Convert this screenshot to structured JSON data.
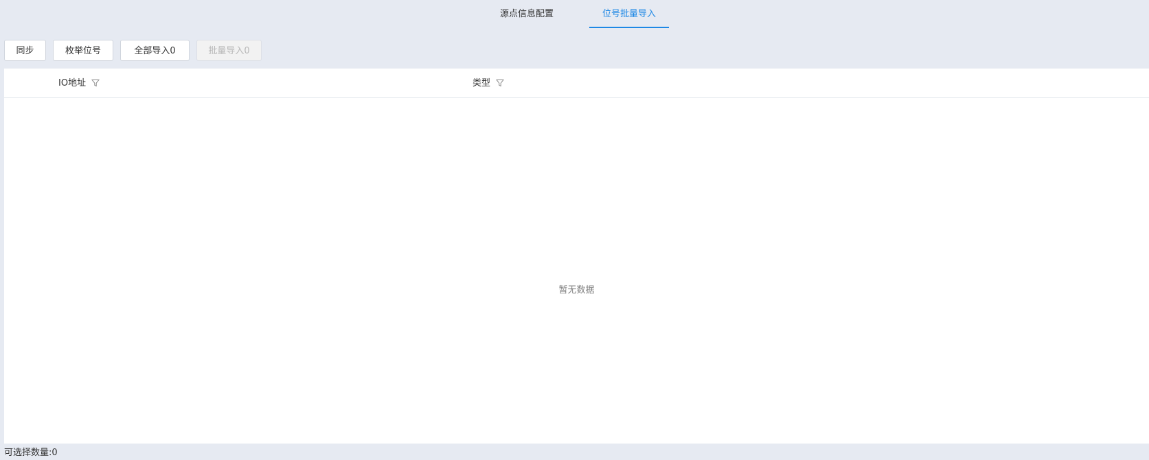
{
  "tabs": [
    {
      "label": "源点信息配置",
      "active": false
    },
    {
      "label": "位号批量导入",
      "active": true
    }
  ],
  "toolbar": {
    "sync_label": "同步",
    "enumerate_label": "枚举位号",
    "import_all_label": "全部导入0",
    "batch_import_label": "批量导入0"
  },
  "table": {
    "columns": [
      {
        "label": "IO地址",
        "icon": "filter-icon"
      },
      {
        "label": "类型",
        "icon": "filter-icon"
      }
    ],
    "empty_text": "暂无数据"
  },
  "footer": {
    "selectable_count_label": "可选择数量:0"
  },
  "colors": {
    "accent": "#1e88e5",
    "page_bg": "#e6eaf2",
    "panel_bg": "#ffffff"
  }
}
